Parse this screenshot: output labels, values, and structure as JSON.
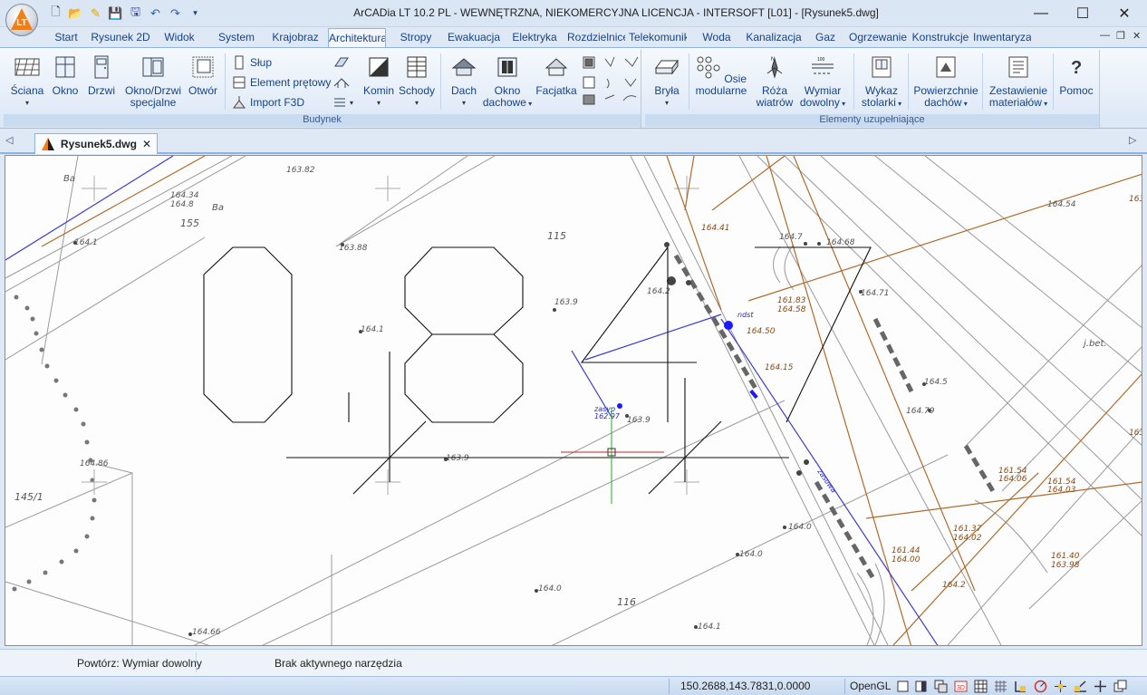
{
  "window": {
    "title": "ArCADia LT 10.2 PL - WEWNĘTRZNA, NIEKOMERCYJNA LICENCJA - INTERSOFT [L01] - [Rysunek5.dwg]",
    "logo_text": "LT"
  },
  "quick_access": [
    "new-icon",
    "open-icon",
    "quick-draw-icon",
    "save-icon",
    "save-as-icon",
    "undo-icon",
    "redo-icon",
    "customize-icon"
  ],
  "ribbon_tabs": [
    "Start",
    "Rysunek 2D",
    "Widok",
    "System",
    "Krajobraz",
    "Architektura",
    "Stropy",
    "Ewakuacja",
    "Elektryka",
    "Rozdzielnice",
    "Telekomunik",
    "Woda",
    "Kanalizacja",
    "Gaz",
    "Ogrzewanie",
    "Konstrukcje",
    "Inwentaryzacja"
  ],
  "active_tab": "Architektura",
  "groups": {
    "budynek": "Budynek",
    "elementy": "Elementy uzupełniające"
  },
  "buttons": {
    "sciana": "Ściana",
    "okno": "Okno",
    "drzwi": "Drzwi",
    "okno_drzwi_1": "Okno/Drzwi",
    "okno_drzwi_2": "specjalne",
    "otwor": "Otwór",
    "slup": "Słup",
    "element_pretowy": "Element prętowy",
    "import_f3d": "Import F3D",
    "komin": "Komin",
    "schody": "Schody",
    "dach": "Dach",
    "okno_dachowe_1": "Okno",
    "okno_dachowe_2": "dachowe",
    "facjatka": "Facjatka",
    "bryla": "Bryła",
    "osie_1": "Osie",
    "osie_2": "modularne",
    "roza_1": "Róża",
    "roza_2": "wiatrów",
    "wymiar_1": "Wymiar",
    "wymiar_2": "dowolny",
    "wykaz_1": "Wykaz",
    "wykaz_2": "stolarki",
    "powierzchnie_1": "Powierzchnie",
    "powierzchnie_2": "dachów",
    "zestawienie_1": "Zestawienie",
    "zestawienie_2": "materiałów",
    "pomoc": "Pomoc"
  },
  "document_tab": "Rysunek5.dwg",
  "canvas_labels": {
    "parcels": [
      "155",
      "115",
      "116",
      "145/1"
    ],
    "usage": [
      "Ba",
      "Ba",
      "Bi",
      "Bi",
      "j.bet."
    ],
    "heights": [
      "163.82",
      "163.88",
      "164.1",
      "163.9",
      "163.9",
      "163.9",
      "164.2",
      "164.86",
      "164.34",
      "164.8",
      "164.1",
      "164.0",
      "164.0",
      "164.0",
      "164.1",
      "164.66",
      "164.7",
      "164.68",
      "164.71",
      "164.5",
      "164.79",
      "164.54",
      "164.41",
      "161.83",
      "164.58",
      "164.50",
      "164.15",
      "161.54",
      "164.06",
      "161.54",
      "164.03",
      "161.44",
      "164.00",
      "161.40",
      "163.98",
      "161.37",
      "164.02",
      "164.2",
      "163.9"
    ],
    "sewer": [
      "zasyp",
      "162.97",
      "ndst",
      "zasuwa"
    ]
  },
  "command_prompt": "Powtórz: Wymiar dowolny",
  "tool_status": "Brak aktywnego narzędzia",
  "coordinates": "150.2688,143.7831,0.0000",
  "render_mode": "OpenGL"
}
